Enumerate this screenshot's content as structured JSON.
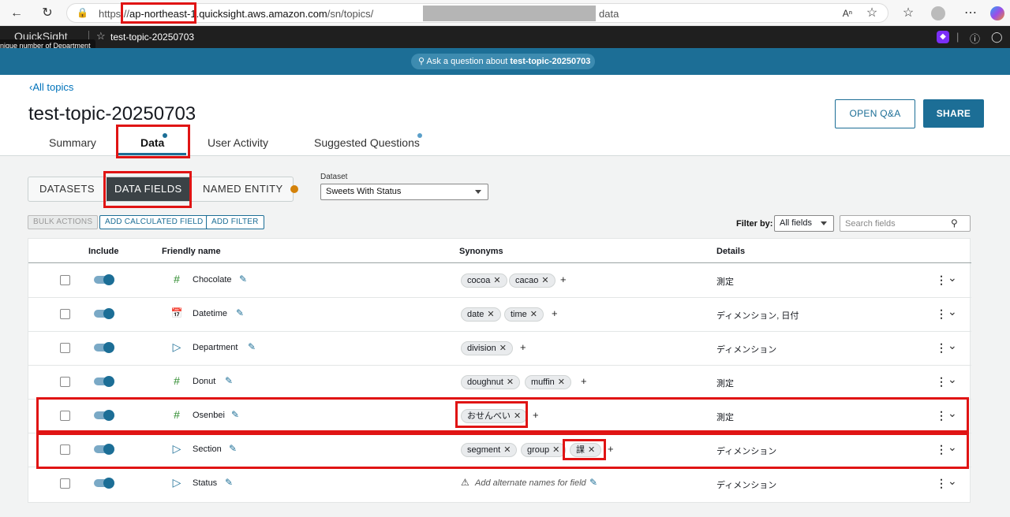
{
  "browser": {
    "url_scheme": "https://",
    "url_host": "ap-northeast-1.quicksight.aws.amazon.com",
    "url_path": "/sn/topics/",
    "url_tail": "data"
  },
  "app": {
    "logo": "QuickSight",
    "topic_name": "test-topic-20250703",
    "tooltip": "nique number of Department",
    "ask_prefix": "Ask a question about ",
    "ask_topic": "test-topic-20250703"
  },
  "header": {
    "back_link": "All topics",
    "title": "test-topic-20250703",
    "open_qa": "OPEN Q&A",
    "share": "SHARE",
    "tabs": [
      "Summary",
      "Data",
      "User Activity",
      "Suggested Questions"
    ]
  },
  "segments": {
    "datasets": "DATASETS",
    "data_fields": "DATA FIELDS",
    "named_entity": "NAMED ENTITY"
  },
  "dataset": {
    "label": "Dataset",
    "value": "Sweets With Status"
  },
  "actions": {
    "bulk": "BULK ACTIONS",
    "add_calc": "ADD CALCULATED FIELD",
    "add_filter": "ADD FILTER",
    "filter_by_label": "Filter by:",
    "filter_by_value": "All fields",
    "search_placeholder": "Search fields"
  },
  "table": {
    "headers": {
      "include": "Include",
      "friendly_name": "Friendly name",
      "synonyms": "Synonyms",
      "details": "Details"
    },
    "add_alternate": "Add alternate names for field",
    "rows": [
      {
        "name": "Chocolate",
        "icon": "hash-icon",
        "synonyms": [
          "cocoa",
          "cacao"
        ],
        "details": "測定"
      },
      {
        "name": "Datetime",
        "icon": "calendar-icon",
        "synonyms": [
          "date",
          "time"
        ],
        "details": "ディメンション, 日付"
      },
      {
        "name": "Department",
        "icon": "tag-icon",
        "synonyms": [
          "division"
        ],
        "details": "ディメンション"
      },
      {
        "name": "Donut",
        "icon": "hash-icon",
        "synonyms": [
          "doughnut",
          "muffin"
        ],
        "details": "測定"
      },
      {
        "name": "Osenbei",
        "icon": "hash-icon",
        "synonyms": [
          "おせんべい"
        ],
        "details": "測定"
      },
      {
        "name": "Section",
        "icon": "tag-icon",
        "synonyms": [
          "segment",
          "group",
          "課"
        ],
        "details": "ディメンション"
      },
      {
        "name": "Status",
        "icon": "tag-icon",
        "synonyms": [],
        "details": "ディメンション"
      }
    ]
  },
  "colors": {
    "accent": "#1c6e96",
    "highlight": "#e01414",
    "measure_icon": "#2e8b2e"
  }
}
